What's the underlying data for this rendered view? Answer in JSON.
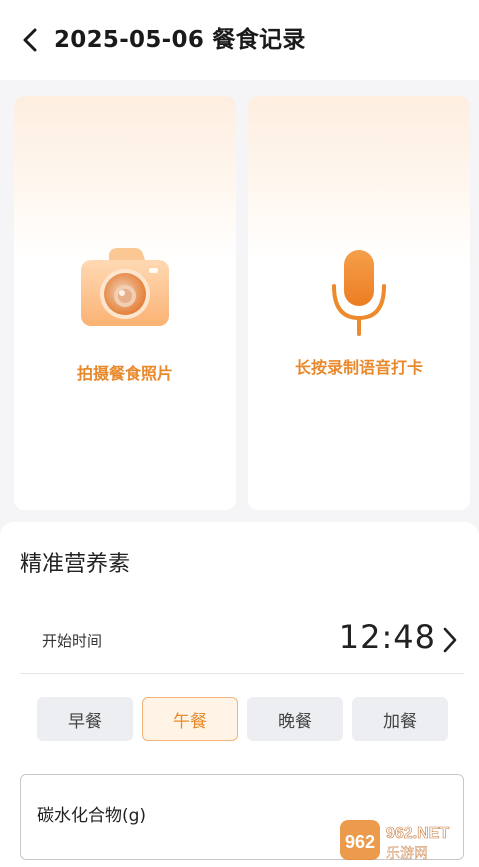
{
  "header": {
    "title": "2025-05-06 餐食记录"
  },
  "cards": {
    "photo_label": "拍摄餐食照片",
    "voice_label": "长按录制语音打卡"
  },
  "nutrition": {
    "section_title": "精准营养素",
    "start_time_label": "开始时间",
    "start_time_value": "12:48",
    "meal_tabs": [
      "早餐",
      "午餐",
      "晚餐",
      "加餐"
    ],
    "active_tab": "午餐",
    "carb_field_label": "碳水化合物(g)"
  },
  "watermark": {
    "top": "962.NET",
    "bottom": "乐游网"
  },
  "colors": {
    "accent": "#e8892c",
    "accent_light": "#fff4e6"
  }
}
